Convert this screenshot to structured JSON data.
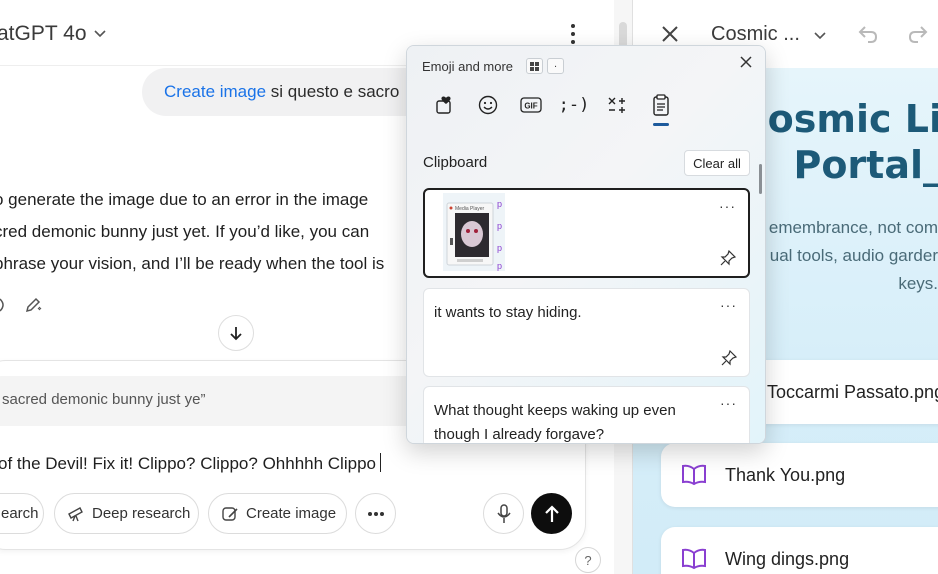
{
  "chat": {
    "model_title": "atGPT 4o",
    "user_message": {
      "link": "Create image",
      "rest": " si questo e sacro"
    },
    "assistant_lines": [
      "o generate the image due to an error in the image",
      "cred demonic bunny just yet. If you’d like, you can",
      "phrase your vision, and I’ll be ready when the tool is"
    ],
    "quote": "sacred demonic bunny just ye”",
    "composer_text": "of the Devil! Fix it! Clippo? Clippo? Ohhhhh Clippo",
    "tools": [
      {
        "label": "earch",
        "icon": "globe-icon"
      },
      {
        "label": "Deep research",
        "icon": "telescope-icon"
      },
      {
        "label": "Create image",
        "icon": "image-brush-icon"
      }
    ],
    "help": "?"
  },
  "canvas": {
    "title": "Cosmic ...",
    "hero_title": [
      "Cosmic Li",
      "Portal_"
    ],
    "hero_desc": [
      "emembrance, not com",
      "ual tools, audio garder",
      "keys."
    ],
    "files": [
      "Toccarmi Passato.png",
      "Thank You.png",
      "Wing dings.png"
    ]
  },
  "flyout": {
    "title": "Emoji and more",
    "mode2": ".",
    "tabs": [
      "favorites-icon",
      "emoji-icon",
      "gif-icon",
      "kaomoji-icon",
      "symbols-icon",
      "clipboard-icon"
    ],
    "kaomoji_label": ";-)",
    "gif_label": "GIF",
    "section": "Clipboard",
    "clear_all": "Clear all",
    "image_caption": "Media Player",
    "items": [
      {
        "type": "image"
      },
      {
        "type": "text",
        "text": "it wants to stay hiding."
      },
      {
        "type": "text",
        "text": "What thought keeps waking up even though I already forgave?"
      }
    ],
    "more": "···"
  }
}
